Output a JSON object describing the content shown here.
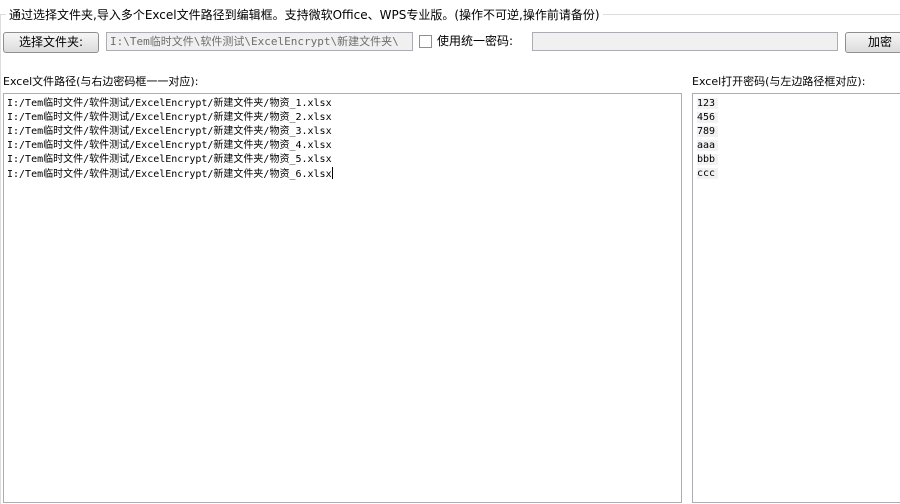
{
  "header": {
    "description": "通过选择文件夹,导入多个Excel文件路径到编辑框。支持微软Office、WPS专业版。(操作不可逆,操作前请备份)"
  },
  "toolbar": {
    "select_folder_label": "选择文件夹:",
    "folder_path_value": "I:\\Tem临时文件\\软件测试\\ExcelEncrypt\\新建文件夹\\",
    "use_unified_password_label": "使用统一密码:",
    "use_unified_password_checked": false,
    "unified_password_value": "",
    "encrypt_label": "加密"
  },
  "paths": {
    "label": "Excel文件路径(与右边密码框一一对应):",
    "lines": [
      "I:/Tem临时文件/软件测试/ExcelEncrypt/新建文件夹/物资_1.xlsx",
      "I:/Tem临时文件/软件测试/ExcelEncrypt/新建文件夹/物资_2.xlsx",
      "I:/Tem临时文件/软件测试/ExcelEncrypt/新建文件夹/物资_3.xlsx",
      "I:/Tem临时文件/软件测试/ExcelEncrypt/新建文件夹/物资_4.xlsx",
      "I:/Tem临时文件/软件测试/ExcelEncrypt/新建文件夹/物资_5.xlsx",
      "I:/Tem临时文件/软件测试/ExcelEncrypt/新建文件夹/物资_6.xlsx"
    ]
  },
  "passwords": {
    "label": "Excel打开密码(与左边路径框对应):",
    "lines": [
      "123",
      "456",
      "789",
      "aaa",
      "bbb",
      "ccc"
    ]
  }
}
